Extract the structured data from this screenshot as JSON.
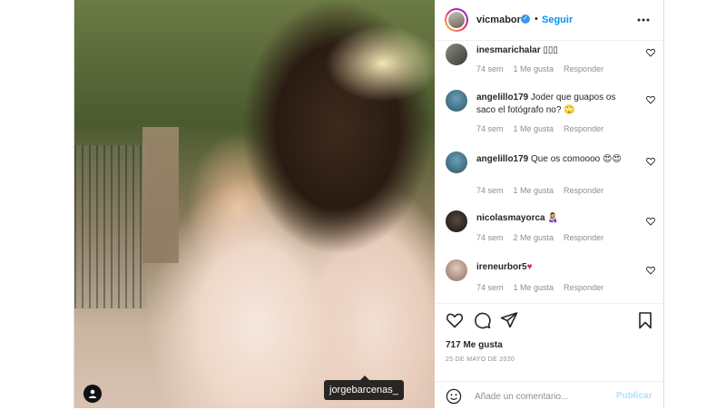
{
  "post": {
    "author": "vicmabor",
    "follow_label": "Seguir",
    "separator": "•",
    "tagged_user": "jorgebarcenas_",
    "likes": "717 Me gusta",
    "date": "25 de mayo de 2020",
    "comment_placeholder": "Añade un comentario...",
    "publish_label": "Publicar"
  },
  "comments": [
    {
      "user": "inesmarichalar",
      "text": "▯▯▯",
      "time": "74 sem",
      "likes": "1 Me gusta",
      "reply": "Responder"
    },
    {
      "user": "angelillo179",
      "text": "Joder que guapos os saco el fotógrafo no? 🙄",
      "time": "74 sem",
      "likes": "1 Me gusta",
      "reply": "Responder"
    },
    {
      "user": "angelillo179",
      "text": "Que os comoooo 😍😍",
      "time": "74 sem",
      "likes": "1 Me gusta",
      "reply": "Responder"
    },
    {
      "user": "nicolasmayorca",
      "text": "👩‍🍼",
      "time": "74 sem",
      "likes": "2 Me gusta",
      "reply": "Responder"
    },
    {
      "user": "ireneurbor5",
      "text": "♥",
      "time": "74 sem",
      "likes": "1 Me gusta",
      "reply": "Responder"
    }
  ],
  "icons": {
    "user_tag": "person-icon",
    "verified": "verified-badge-icon",
    "more": "more-options-icon",
    "heart": "heart-icon",
    "comment": "comment-icon",
    "share": "share-icon",
    "save": "bookmark-icon",
    "emoji": "emoji-icon"
  },
  "colors": {
    "accent": "#0095f6",
    "verified": "#3897f0",
    "muted": "#8e8e8e",
    "publish_disabled": "#b2dffc"
  }
}
